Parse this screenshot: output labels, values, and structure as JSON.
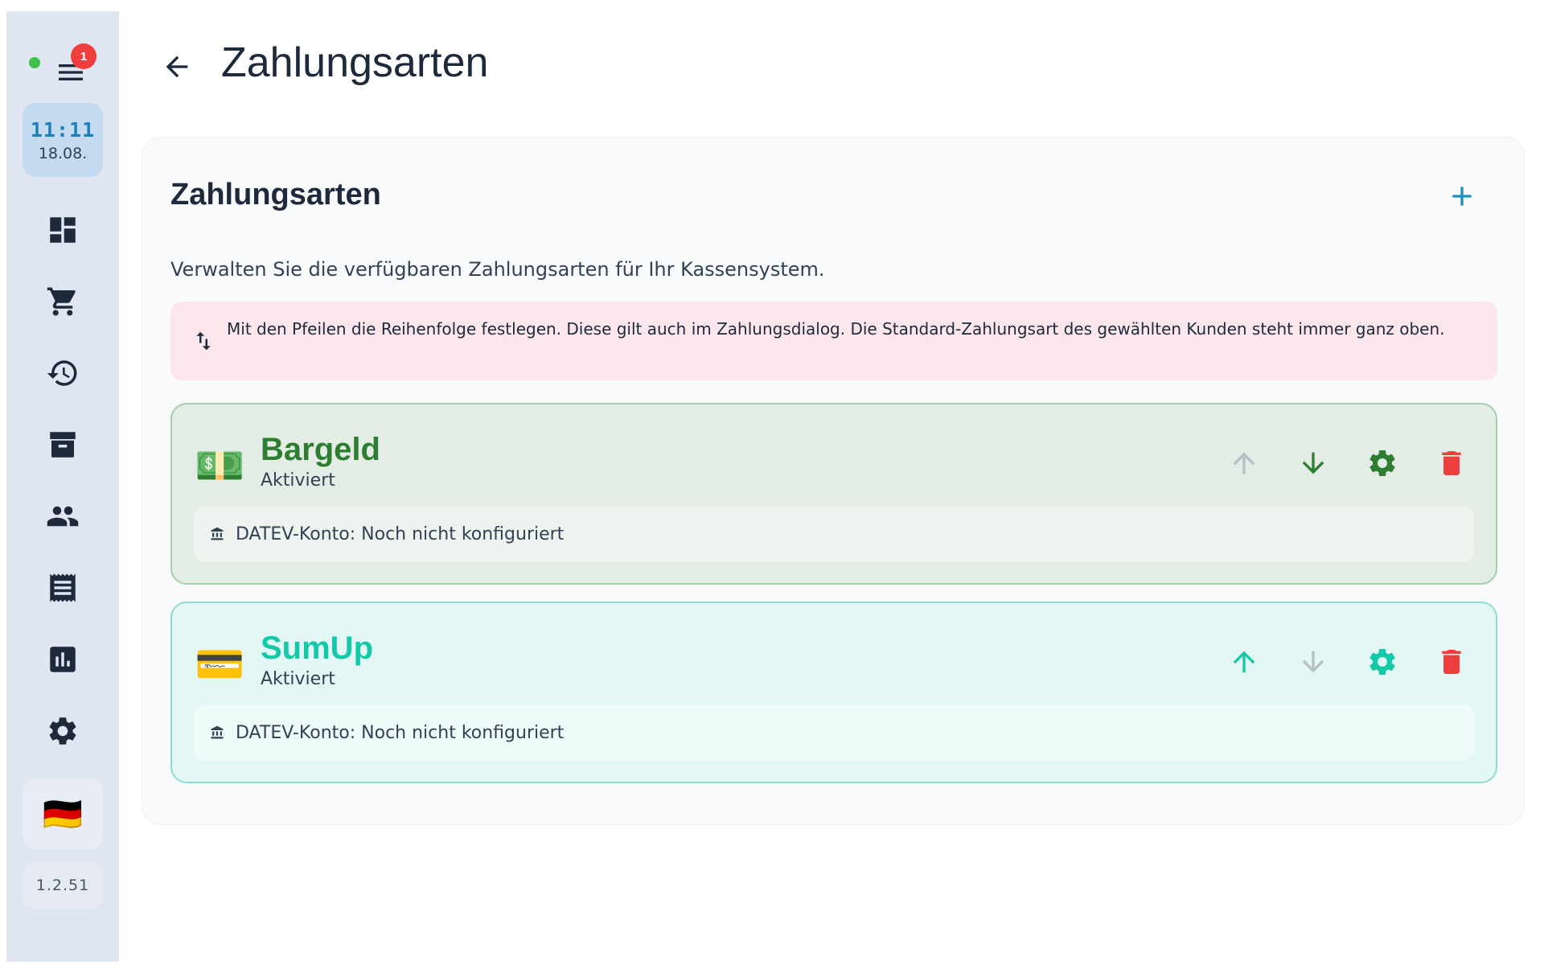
{
  "sidebar": {
    "badge_count": "1",
    "clock_time": "11:11",
    "clock_date": "18.08.",
    "nav": [
      "dashboard-icon",
      "cart-icon",
      "history-icon",
      "archive-icon",
      "people-icon",
      "receipt-icon",
      "chart-icon",
      "settings-icon"
    ],
    "language_flag": "🇩🇪",
    "version": "1.2.51"
  },
  "header": {
    "title": "Zahlungsarten"
  },
  "panel": {
    "title": "Zahlungsarten",
    "description": "Verwalten Sie die verfügbaren Zahlungsarten für Ihr Kassensystem.",
    "hint": "Mit den Pfeilen die Reihenfolge festlegen. Diese gilt auch im Zahlungsdialog. Die Standard-Zahlungsart des gewählten Kunden steht immer ganz oben."
  },
  "payment_methods": [
    {
      "emoji": "💵",
      "name": "Bargeld",
      "status": "Aktiviert",
      "datev": "DATEV-Konto: Noch nicht konfiguriert",
      "color": "#2e7d32",
      "up_enabled": false,
      "down_enabled": true
    },
    {
      "emoji": "💳",
      "name": "SumUp",
      "status": "Aktiviert",
      "datev": "DATEV-Konto: Noch nicht konfiguriert",
      "color": "#14c9a8",
      "up_enabled": true,
      "down_enabled": false
    }
  ],
  "colors": {
    "delete": "#ee3e3e",
    "disabled": "#b8bec6",
    "accent": "#1f8fc0"
  }
}
